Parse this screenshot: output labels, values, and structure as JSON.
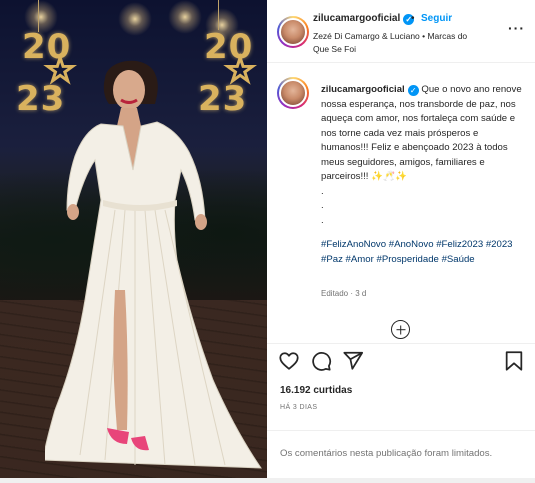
{
  "post": {
    "username": "zilucamargooficial",
    "verified_mark": "✓",
    "separator": "•",
    "follow_label": "Seguir",
    "audio": "Zezé Di Camargo & Luciano • Marcas do Que Se Foi",
    "more_label": "···"
  },
  "photo": {
    "year_top": "20",
    "year_bottom": "23",
    "star_glyph": "☆"
  },
  "caption": {
    "username": "zilucamargooficial",
    "text": "Que o novo ano renove nossa esperança, nos transborde de paz, nos aqueça com amor, nos fortaleça com saúde e nos torne cada vez mais prósperos e humanos!!! Feliz e abençoado 2023 à todos meus seguidores, amigos, familiares e parceiros!!! ✨🥂✨\n.\n.\n.",
    "hashtags": [
      "#FelizAnoNovo",
      "#AnoNovo",
      "#Feliz2023",
      "#2023",
      "#Paz",
      "#Amor",
      "#Prosperidade",
      "#Saúde"
    ],
    "edited_label": "Editado",
    "edited_time": "3 d"
  },
  "actions": {
    "like_icon": "heart-icon",
    "comment_icon": "comment-icon",
    "share_icon": "share-icon",
    "save_icon": "bookmark-icon"
  },
  "stats": {
    "likes": "16.192 curtidas",
    "posted": "HÁ 3 DIAS",
    "comments_limited": "Os comentários nesta publicação foram limitados."
  },
  "colors": {
    "accent": "#0095f6",
    "hashtag": "#00376b",
    "muted": "#737373",
    "gold": "#d9b25e",
    "dress": "#f3efe6",
    "shoes": "#e8457a"
  }
}
